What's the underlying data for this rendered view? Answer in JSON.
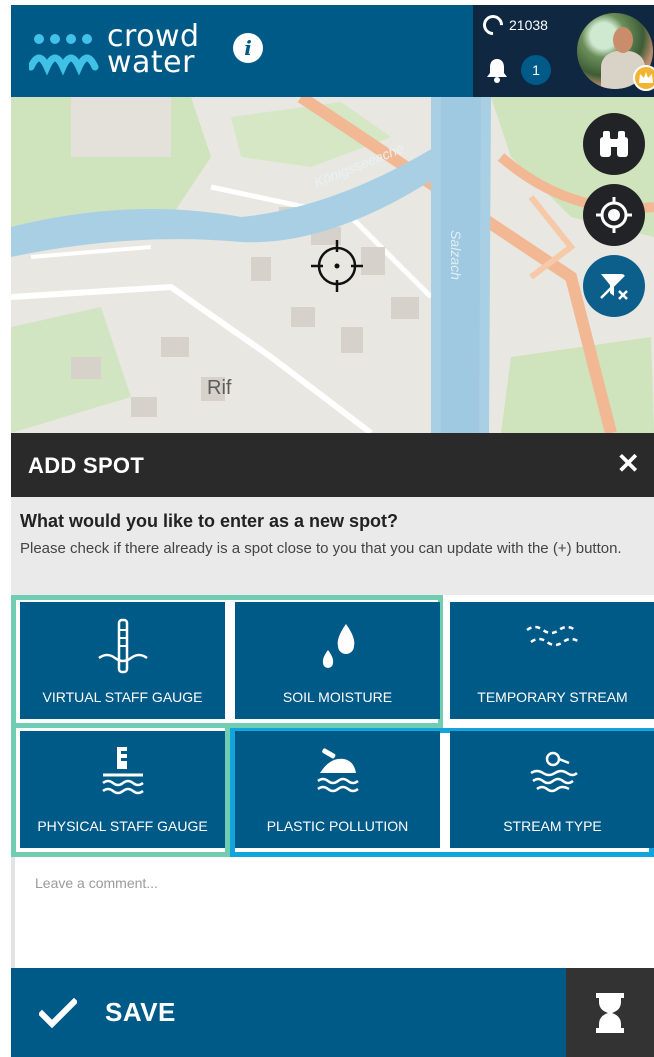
{
  "header": {
    "brand_line1": "crowd",
    "brand_line2": "water",
    "info_label": "i",
    "points": "21038",
    "notifications": "1"
  },
  "map": {
    "place_label": "Rif",
    "river_label_1": "Königsseeache",
    "river_label_2": "Salzach"
  },
  "panel": {
    "title": "ADD SPOT",
    "close_label": "✕",
    "question": "What would you like to enter as a new spot?",
    "hint": "Please check if there already is a spot close to you that you can update with the (+) button."
  },
  "tiles": [
    {
      "label": "VIRTUAL STAFF GAUGE",
      "icon": "virtual-staff-gauge-icon"
    },
    {
      "label": "SOIL MOISTURE",
      "icon": "water-drops-icon"
    },
    {
      "label": "TEMPORARY STREAM",
      "icon": "temporary-stream-icon"
    },
    {
      "label": "PHYSICAL STAFF GAUGE",
      "icon": "physical-staff-gauge-icon"
    },
    {
      "label": "PLASTIC POLLUTION",
      "icon": "plastic-pollution-icon"
    },
    {
      "label": "STREAM TYPE",
      "icon": "stream-type-icon"
    }
  ],
  "comment": {
    "placeholder": "Leave a comment..."
  },
  "footer": {
    "save_label": "SAVE"
  },
  "colors": {
    "primary": "#005a87",
    "dark": "#0f2740",
    "green_frame": "#70cdb2",
    "blue_frame": "#12a4dc",
    "crown": "#f2b431"
  }
}
